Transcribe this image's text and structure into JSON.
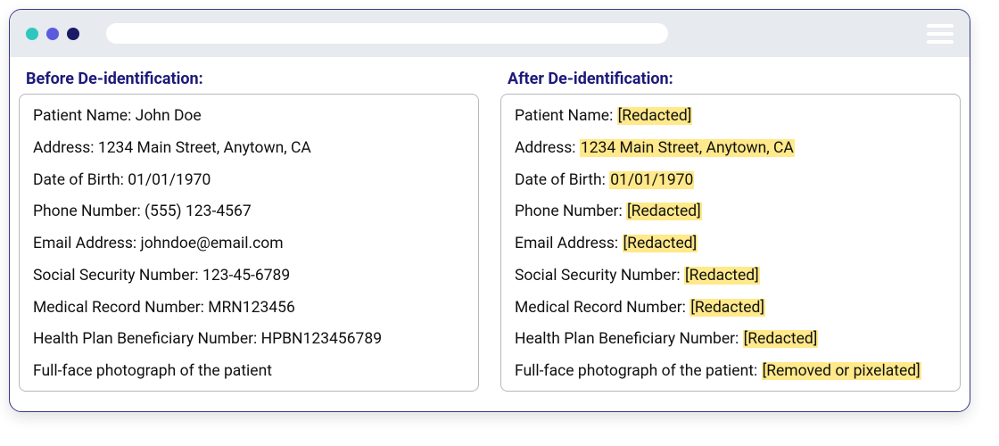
{
  "titlebar": {
    "urlValue": ""
  },
  "panels": {
    "before": {
      "title": "Before De-identification:",
      "rows": [
        {
          "label": "Patient Name: ",
          "value": "John Doe"
        },
        {
          "label": "Address: ",
          "value": "1234 Main Street, Anytown, CA"
        },
        {
          "label": "Date of Birth: ",
          "value": "01/01/1970"
        },
        {
          "label": "Phone Number: ",
          "value": "(555) 123-4567"
        },
        {
          "label": "Email Address: ",
          "value": "johndoe@email.com"
        },
        {
          "label": "Social Security Number: ",
          "value": "123-45-6789"
        },
        {
          "label": "Medical Record Number: ",
          "value": "MRN123456"
        },
        {
          "label": "Health Plan Beneficiary Number: ",
          "value": "HPBN123456789"
        },
        {
          "label": "Full-face photograph of the patient",
          "value": ""
        }
      ]
    },
    "after": {
      "title": "After De-identification:",
      "rows": [
        {
          "label": "Patient Name: ",
          "value": "[Redacted]"
        },
        {
          "label": "Address: ",
          "value": "1234 Main Street, Anytown, CA"
        },
        {
          "label": "Date of Birth: ",
          "value": "01/01/1970"
        },
        {
          "label": "Phone Number: ",
          "value": "[Redacted]"
        },
        {
          "label": "Email Address: ",
          "value": "[Redacted]"
        },
        {
          "label": "Social Security Number: ",
          "value": "[Redacted]"
        },
        {
          "label": "Medical Record Number: ",
          "value": "[Redacted]"
        },
        {
          "label": "Health Plan Beneficiary Number: ",
          "value": "[Redacted]"
        },
        {
          "label": "Full-face photograph of the patient: ",
          "value": "[Removed or pixelated]"
        }
      ]
    }
  },
  "colors": {
    "accent": "#1d1a7a",
    "highlight": "#ffe98a",
    "border": "#3a3a8a",
    "titlebarBg": "#e7eaef"
  }
}
